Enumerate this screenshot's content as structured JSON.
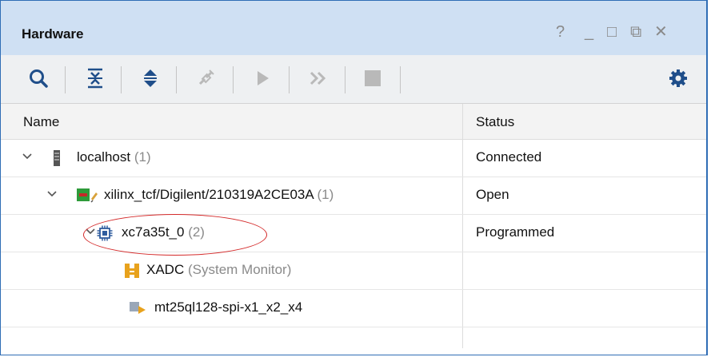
{
  "window": {
    "title": "Hardware",
    "controls": [
      "?",
      "_",
      "□",
      "⧉",
      "✕"
    ]
  },
  "toolbar": {
    "buttons": [
      {
        "name": "search-icon",
        "enabled": true
      },
      {
        "name": "collapse-all-icon",
        "enabled": true
      },
      {
        "name": "expand-all-icon",
        "enabled": true
      },
      {
        "name": "auto-connect-icon",
        "enabled": false
      },
      {
        "name": "run-trigger-icon",
        "enabled": false
      },
      {
        "name": "run-trigger-immediate-icon",
        "enabled": false
      },
      {
        "name": "stop-trigger-icon",
        "enabled": false
      },
      {
        "name": "gear-icon",
        "enabled": true
      }
    ]
  },
  "table": {
    "columns": [
      "Name",
      "Status"
    ],
    "rows": [
      {
        "label": "localhost",
        "count": "(1)",
        "status": "Connected",
        "icon": "server-icon"
      },
      {
        "label": "xilinx_tcf/Digilent/210319A2CE03A",
        "count": "(1)",
        "status": "Open",
        "icon": "jtag-cable-icon"
      },
      {
        "label": "xc7a35t_0",
        "count": "(2)",
        "status": "Programmed",
        "icon": "fpga-chip-icon"
      },
      {
        "label": "XADC",
        "count": "(System Monitor)",
        "status": "",
        "icon": "xadc-icon"
      },
      {
        "label": "mt25ql128-spi-x1_x2_x4",
        "count": "",
        "status": "",
        "icon": "flash-memory-icon"
      }
    ]
  },
  "colors": {
    "titlebar": "#cfe0f3",
    "border": "#2f6db5",
    "annotation": "#d42a2a"
  }
}
